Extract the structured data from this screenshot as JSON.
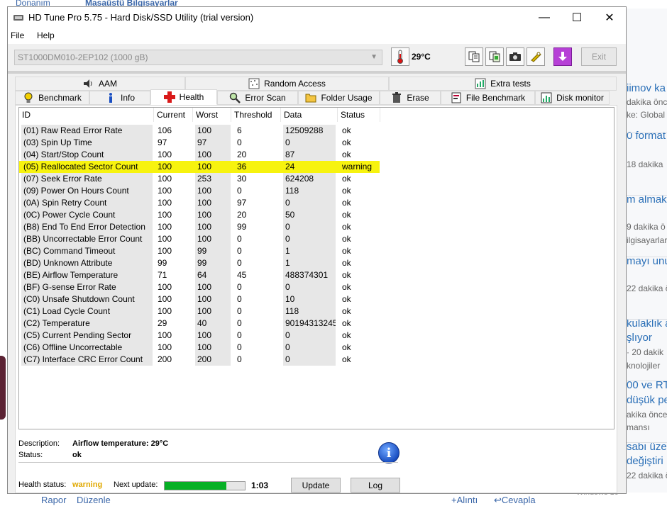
{
  "background": {
    "top_crumbs": [
      "Donanım",
      "Masaüstü Bilgisayarlar"
    ],
    "right_lines": [
      {
        "text": "iimov ka",
        "style": "big"
      },
      {
        "text": "dakika önce",
        "style": "small"
      },
      {
        "text": "ke: Global",
        "style": "small"
      },
      {
        "text": "0 format",
        "style": "big"
      },
      {
        "text": "18 dakika",
        "style": "small"
      },
      {
        "text": "m almak",
        "style": "big"
      },
      {
        "text": "9 dakika ö",
        "style": "small"
      },
      {
        "text": "ilgisayarlar",
        "style": "small"
      },
      {
        "text": "mayı unu",
        "style": "big"
      },
      {
        "text": "22 dakika ö",
        "style": "small"
      },
      {
        "text": "kulaklık a",
        "style": "big"
      },
      {
        "text": "şlıyor",
        "style": "big"
      },
      {
        "text": "· 20 dakik",
        "style": "small"
      },
      {
        "text": "knolojiler",
        "style": "small"
      },
      {
        "text": "00 ve RT",
        "style": "big"
      },
      {
        "text": "düşük pe",
        "style": "big"
      },
      {
        "text": "akika önce",
        "style": "small"
      },
      {
        "text": "mansı",
        "style": "small"
      },
      {
        "text": "sabı üzeri",
        "style": "big"
      },
      {
        "text": "değiştiri",
        "style": "big"
      },
      {
        "text": "22 dakika ö",
        "style": "small"
      }
    ],
    "bottom_links": [
      "Rapor",
      "Düzenle",
      "+Alıntı",
      "Cevapla"
    ],
    "windows_text": "Windows 10"
  },
  "window": {
    "title": "HD Tune Pro 5.75 - Hard Disk/SSD Utility (trial version)",
    "controls": {
      "minimize": "—",
      "maximize": "☐",
      "close": "✕"
    }
  },
  "menu": {
    "file": "File",
    "help": "Help"
  },
  "toolbar": {
    "drive": "ST1000DM010-2EP102 (1000 gB)",
    "temperature": "29°C",
    "exit": "Exit"
  },
  "tabs_top": [
    {
      "label": "AAM",
      "icon": "speaker-icon"
    },
    {
      "label": "Random Access",
      "icon": "random-access-icon"
    },
    {
      "label": "Extra tests",
      "icon": "extra-tests-icon"
    }
  ],
  "tabs_bottom": [
    {
      "label": "Benchmark",
      "icon": "lightbulb-icon"
    },
    {
      "label": "Info",
      "icon": "info-icon"
    },
    {
      "label": "Health",
      "icon": "red-cross-icon",
      "active": true
    },
    {
      "label": "Error Scan",
      "icon": "magnifier-icon"
    },
    {
      "label": "Folder Usage",
      "icon": "folder-icon"
    },
    {
      "label": "Erase",
      "icon": "trash-icon"
    },
    {
      "label": "File Benchmark",
      "icon": "file-benchmark-icon"
    },
    {
      "label": "Disk monitor",
      "icon": "disk-monitor-icon"
    }
  ],
  "table": {
    "headers": [
      "ID",
      "Current",
      "Worst",
      "Threshold",
      "Data",
      "Status"
    ],
    "rows": [
      {
        "id": "(01) Raw Read Error Rate",
        "current": "106",
        "worst": "100",
        "threshold": "6",
        "data": "12509288",
        "status": "ok",
        "highlight": false
      },
      {
        "id": "(03) Spin Up Time",
        "current": "97",
        "worst": "97",
        "threshold": "0",
        "data": "0",
        "status": "ok",
        "highlight": false
      },
      {
        "id": "(04) Start/Stop Count",
        "current": "100",
        "worst": "100",
        "threshold": "20",
        "data": "87",
        "status": "ok",
        "highlight": false
      },
      {
        "id": "(05) Reallocated Sector Count",
        "current": "100",
        "worst": "100",
        "threshold": "36",
        "data": "24",
        "status": "warning",
        "highlight": true
      },
      {
        "id": "(07) Seek Error Rate",
        "current": "100",
        "worst": "253",
        "threshold": "30",
        "data": "624208",
        "status": "ok",
        "highlight": false
      },
      {
        "id": "(09) Power On Hours Count",
        "current": "100",
        "worst": "100",
        "threshold": "0",
        "data": "118",
        "status": "ok",
        "highlight": false
      },
      {
        "id": "(0A) Spin Retry Count",
        "current": "100",
        "worst": "100",
        "threshold": "97",
        "data": "0",
        "status": "ok",
        "highlight": false
      },
      {
        "id": "(0C) Power Cycle Count",
        "current": "100",
        "worst": "100",
        "threshold": "20",
        "data": "50",
        "status": "ok",
        "highlight": false
      },
      {
        "id": "(B8) End To End Error Detection",
        "current": "100",
        "worst": "100",
        "threshold": "99",
        "data": "0",
        "status": "ok",
        "highlight": false
      },
      {
        "id": "(BB) Uncorrectable Error Count",
        "current": "100",
        "worst": "100",
        "threshold": "0",
        "data": "0",
        "status": "ok",
        "highlight": false
      },
      {
        "id": "(BC) Command Timeout",
        "current": "100",
        "worst": "99",
        "threshold": "0",
        "data": "1",
        "status": "ok",
        "highlight": false
      },
      {
        "id": "(BD) Unknown Attribute",
        "current": "99",
        "worst": "99",
        "threshold": "0",
        "data": "1",
        "status": "ok",
        "highlight": false
      },
      {
        "id": "(BE) Airflow Temperature",
        "current": "71",
        "worst": "64",
        "threshold": "45",
        "data": "488374301",
        "status": "ok",
        "highlight": false
      },
      {
        "id": "(BF) G-sense Error Rate",
        "current": "100",
        "worst": "100",
        "threshold": "0",
        "data": "0",
        "status": "ok",
        "highlight": false
      },
      {
        "id": "(C0) Unsafe Shutdown Count",
        "current": "100",
        "worst": "100",
        "threshold": "0",
        "data": "10",
        "status": "ok",
        "highlight": false
      },
      {
        "id": "(C1) Load Cycle Count",
        "current": "100",
        "worst": "100",
        "threshold": "0",
        "data": "118",
        "status": "ok",
        "highlight": false
      },
      {
        "id": "(C2) Temperature",
        "current": "29",
        "worst": "40",
        "threshold": "0",
        "data": "90194313245",
        "status": "ok",
        "highlight": false
      },
      {
        "id": "(C5) Current Pending Sector",
        "current": "100",
        "worst": "100",
        "threshold": "0",
        "data": "0",
        "status": "ok",
        "highlight": false
      },
      {
        "id": "(C6) Offline Uncorrectable",
        "current": "100",
        "worst": "100",
        "threshold": "0",
        "data": "0",
        "status": "ok",
        "highlight": false
      },
      {
        "id": "(C7) Interface CRC Error Count",
        "current": "200",
        "worst": "200",
        "threshold": "0",
        "data": "0",
        "status": "ok",
        "highlight": false
      }
    ]
  },
  "details": {
    "description_label": "Description:",
    "description_value": "Airflow temperature: 29°C",
    "status_label": "Status:",
    "status_value": "ok"
  },
  "footer": {
    "health_label": "Health status:",
    "health_value": "warning",
    "next_update_label": "Next update:",
    "progress": 0.77,
    "time": "1:03",
    "update_button": "Update",
    "log_button": "Log"
  },
  "colors": {
    "warning_row": "#f7f30f",
    "warning_text": "#e0a800",
    "progress_fill": "#06b025"
  }
}
